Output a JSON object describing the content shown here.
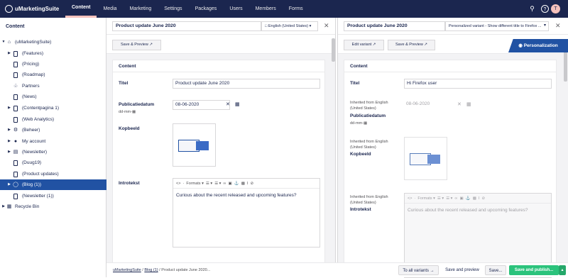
{
  "app": {
    "brand": "uMarketingSuite",
    "user_initial": "T"
  },
  "nav": [
    "Content",
    "Media",
    "Marketing",
    "Settings",
    "Packages",
    "Users",
    "Members",
    "Forms"
  ],
  "tree": {
    "title": "Content",
    "items": [
      "(uMarketingSuite)",
      "(Features)",
      "(Pricing)",
      "(Roadmap)",
      "Partners",
      "(News)",
      "(Contentpagina 1)",
      "(Web Analytics)",
      "(Beheer)",
      "My account",
      "(Newsletter)",
      "(Duug19)",
      "(Product updates)",
      "(Blog (1))",
      "(Newsletter (1))",
      "Recycle Bin"
    ]
  },
  "left": {
    "title": "Product update June 2020",
    "language": "English (United States)",
    "save_preview": "Save & Preview",
    "content_header": "Content",
    "titel_label": "Titel",
    "titel_value": "Product update June 2020",
    "pub_label": "Publicatiedatum",
    "pub_format": "dd-mm-",
    "pub_value": "08-06-2020",
    "kop_label": "Kopbeeld",
    "intro_label": "Introtekst",
    "formats": "Formats",
    "intro_text": "Curious about the recent released and upcoming features?"
  },
  "right": {
    "title": "Product update June 2020",
    "variant": "Personalized variant - Show different title to Firefox ...",
    "edit_variant": "Edit variant",
    "save_preview": "Save & Preview",
    "personalization": "Personalization",
    "content_header": "Content",
    "titel_label": "Titel",
    "titel_value": "Hi Firefox user",
    "inherited": "Inherited from English (United States)",
    "pub_label": "Publicatiedatum",
    "pub_format": "dd-mm-",
    "pub_value": "08-06-2020",
    "kop_label": "Kopbeeld",
    "intro_label": "Introtekst",
    "formats": "Formats",
    "intro_text": "Curious about the recent released and upcoming features?"
  },
  "footer": {
    "crumb1": "uMarketingSuite",
    "crumb2": "Blog (1)",
    "crumb3": "Product update June 2020...",
    "to_all": "To all variants",
    "save_preview": "Save and preview",
    "save": "Save...",
    "save_publish": "Save and publish..."
  },
  "colors": {
    "topbar": "#1b264f",
    "accent": "#2152a3",
    "green": "#2bc37c"
  }
}
